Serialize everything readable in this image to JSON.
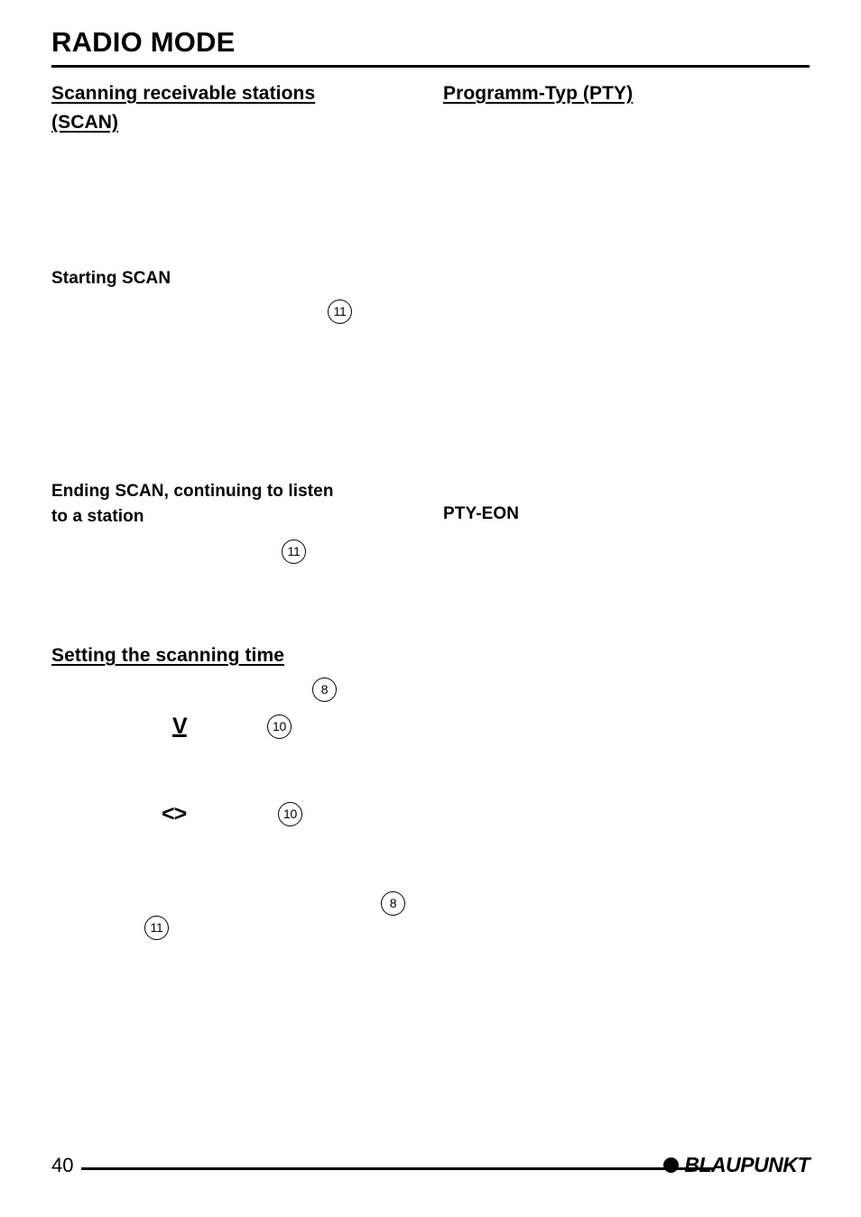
{
  "document": {
    "title": "RADIO MODE",
    "page_number": "40",
    "brand": "BLAUPUNKT",
    "brand_dot_icon": "filled-circle-icon"
  },
  "left_column": {
    "heading": "Scanning receivable stations (SCAN)",
    "heading_line_1": "Scanning receivable stations",
    "heading_line_2": "(SCAN)",
    "subheading_starting_scan": "Starting SCAN",
    "subheading_ending_scan_line_1": "Ending SCAN, continuing to listen",
    "subheading_ending_scan_line_2": "to a station",
    "heading_scanning_time": "Setting the scanning time",
    "markers": {
      "starting_scan": "11",
      "ending_scan": "11",
      "scanning_time_menu": "8",
      "scanning_time_down": "10",
      "scanning_time_leftright": "10",
      "confirm": "8",
      "exit": "11"
    },
    "glyphs": {
      "down_arrow": "V",
      "left_right_arrows": "<>"
    }
  },
  "right_column": {
    "heading": "Programm-Typ (PTY)",
    "subheading_pty_eon": "PTY-EON"
  }
}
